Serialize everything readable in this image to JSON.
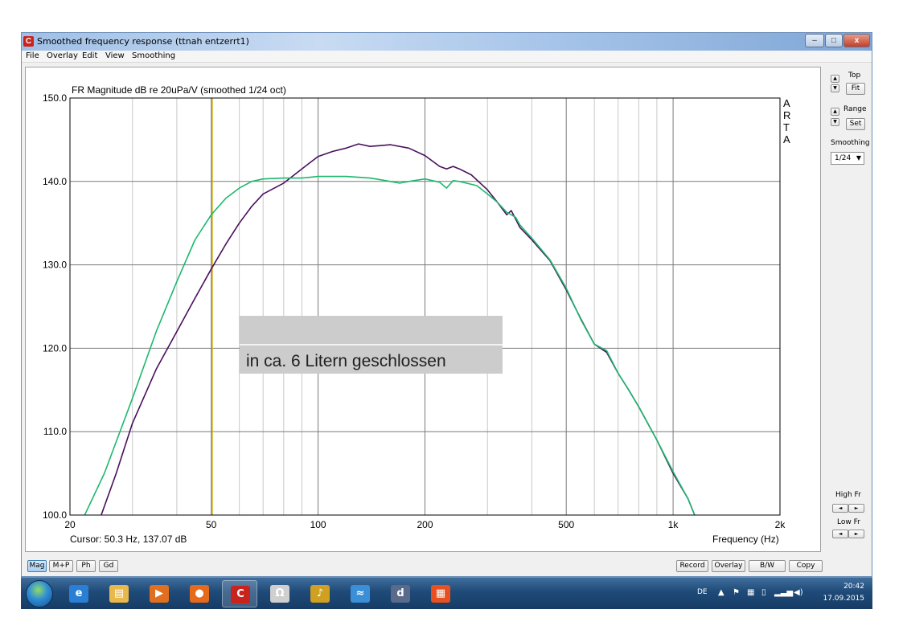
{
  "window": {
    "title": "Smoothed frequency response (ttnah entzerrt1)",
    "icon_label": "C",
    "minimize_symbol": "–",
    "maximize_symbol": "□",
    "close_symbol": "x"
  },
  "menu": [
    "File",
    "Overlay",
    "Edit",
    "View",
    "Smoothing"
  ],
  "plot": {
    "ylabel": "FR Magnitude dB re 20uPa/V (smoothed 1/24 oct)",
    "xlabel": "Frequency (Hz)",
    "watermark": [
      "A",
      "R",
      "T",
      "A"
    ],
    "cursor_readout": "Cursor: 50.3 Hz, 137.07 dB",
    "annotation_text": "in ca. 6 Litern geschlossen",
    "colors": {
      "purple_series": "#4a0f5c",
      "green_series": "#1db86e",
      "cursor_line": "#c8a400",
      "grid": "#c8c8c8",
      "frame": "#000000",
      "annotation_box": "#cccccc"
    }
  },
  "chart_data": {
    "type": "line",
    "x_scale": "log",
    "xlim": [
      20,
      2000
    ],
    "ylim": [
      100,
      150
    ],
    "xlabel": "Frequency (Hz)",
    "ylabel": "FR Magnitude dB re 20uPa/V (smoothed 1/24 oct)",
    "x_ticks": [
      20,
      50,
      100,
      200,
      500,
      1000,
      2000
    ],
    "x_tick_labels": [
      "20",
      "50",
      "100",
      "200",
      "500",
      "1k",
      "2k"
    ],
    "y_ticks": [
      100,
      110,
      120,
      130,
      140,
      150
    ],
    "y_tick_labels": [
      "100.0",
      "110.0",
      "120.0",
      "130.0",
      "140.0",
      "150.0"
    ],
    "grid": true,
    "cursor": {
      "x": 50.3,
      "y": 137.07
    },
    "series": [
      {
        "color": "#4a0f5c",
        "x": [
          24.5,
          27,
          30,
          35,
          40,
          45,
          50,
          55,
          60,
          65,
          70,
          80,
          90,
          100,
          110,
          120,
          130,
          140,
          150,
          160,
          180,
          200,
          220,
          230,
          240,
          250,
          270,
          300,
          320,
          340,
          350,
          360,
          370,
          400,
          450,
          500,
          550,
          600,
          650,
          700,
          750,
          800,
          900,
          1000,
          1100,
          1150
        ],
        "y": [
          100,
          105,
          111,
          117.5,
          122,
          126,
          129.5,
          132.5,
          135,
          137,
          138.5,
          139.8,
          141.5,
          143,
          143.6,
          144,
          144.5,
          144.2,
          144.3,
          144.4,
          144,
          143.1,
          141.8,
          141.5,
          141.8,
          141.5,
          140.8,
          139,
          137.5,
          136,
          136.5,
          135.5,
          134.5,
          133,
          130.5,
          127,
          123.5,
          120.5,
          119.5,
          117,
          115,
          113,
          109,
          105,
          102,
          100
        ]
      },
      {
        "color": "#1db86e",
        "x": [
          22,
          25,
          30,
          35,
          40,
          45,
          50,
          55,
          60,
          65,
          70,
          80,
          90,
          100,
          120,
          140,
          150,
          170,
          180,
          200,
          220,
          230,
          240,
          250,
          280,
          300,
          320,
          340,
          350,
          360,
          370,
          400,
          450,
          500,
          550,
          600,
          650,
          700,
          750,
          800,
          900,
          1000,
          1100,
          1150
        ],
        "y": [
          100,
          105,
          114,
          122,
          128,
          133,
          136,
          138,
          139.2,
          140,
          140.3,
          140.4,
          140.4,
          140.6,
          140.6,
          140.4,
          140.2,
          139.8,
          140,
          140.3,
          139.9,
          139.2,
          140.1,
          140,
          139.5,
          138.5,
          137.5,
          136.3,
          136,
          135.7,
          134.8,
          133.2,
          130.6,
          127.2,
          123.4,
          120.5,
          119.7,
          117,
          115,
          113,
          109,
          105.2,
          102,
          100
        ]
      }
    ]
  },
  "sidebar": {
    "top_label": "Top",
    "fit_label": "Fit",
    "range_label": "Range",
    "set_label": "Set",
    "smoothing_label": "Smoothing",
    "smoothing_value": "1/24",
    "high_fr_label": "High Fr",
    "low_fr_label": "Low Fr",
    "up_symbol": "▲",
    "down_symbol": "▼",
    "left_symbol": "◄",
    "right_symbol": "►",
    "dropdown_symbol": "▼"
  },
  "bottom": {
    "tabs": [
      "Mag",
      "M+P",
      "Ph",
      "Gd"
    ],
    "actions": [
      "Record",
      "Overlay",
      "B/W",
      "Copy"
    ]
  },
  "taskbar": {
    "apps": [
      {
        "icon": "internet-explorer-icon",
        "glyph": "e",
        "color": "#2a7fd4"
      },
      {
        "icon": "file-explorer-icon",
        "glyph": "▤",
        "color": "#e8b84a"
      },
      {
        "icon": "media-player-icon",
        "glyph": "▶",
        "color": "#e07020"
      },
      {
        "icon": "firefox-icon",
        "glyph": "●",
        "color": "#e56a1b"
      },
      {
        "icon": "arta-icon",
        "glyph": "C",
        "color": "#c8241d"
      },
      {
        "icon": "omega-icon",
        "glyph": "Ω",
        "color": "#cfcfcf"
      },
      {
        "icon": "audio-tool-icon",
        "glyph": "♪",
        "color": "#d0a020"
      },
      {
        "icon": "thunderbird-icon",
        "glyph": "≈",
        "color": "#3a8fd8"
      },
      {
        "icon": "dsp-tool-icon",
        "glyph": "d",
        "color": "#5a6a8a"
      },
      {
        "icon": "windows-tiles-icon",
        "glyph": "▦",
        "color": "#e85020"
      }
    ],
    "language": "DE",
    "time": "20:42",
    "date": "17.09.2015"
  }
}
